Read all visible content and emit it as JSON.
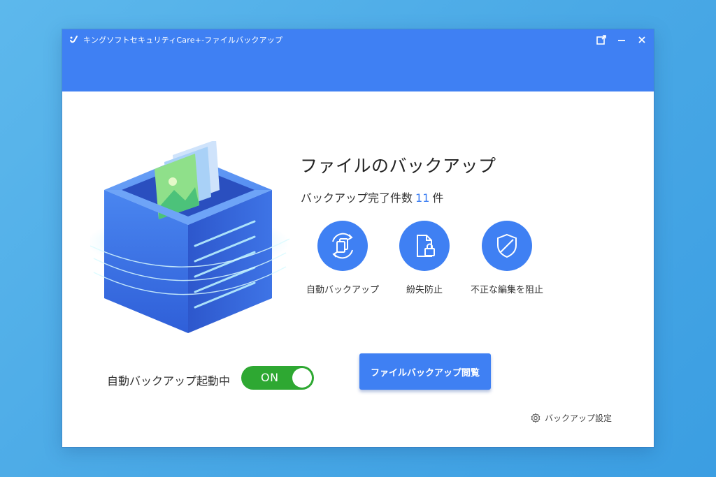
{
  "window": {
    "title": "キングソフトセキュリティCare+-ファイルバックアップ",
    "controls": {
      "new_window_icon": "new-window-icon",
      "minimize_icon": "minimize-icon",
      "close_icon": "close-icon"
    }
  },
  "main": {
    "heading": "ファイルのバックアップ",
    "count_prefix": "バックアップ完了件数",
    "count_value": "11",
    "count_suffix": "件",
    "features": [
      {
        "label": "自動バックアップ",
        "icon": "copy-sync-icon"
      },
      {
        "label": "紛失防止",
        "icon": "file-lock-icon"
      },
      {
        "label": "不正な編集を阻止",
        "icon": "shield-icon"
      }
    ],
    "auto_backup_label": "自動バックアップ起動中",
    "toggle": {
      "state": "ON",
      "on": true
    },
    "browse_button": "ファイルバックアップ閲覧",
    "settings_link": "バックアップ設定"
  },
  "colors": {
    "accent": "#3f80f3",
    "toggle_on": "#2ea832",
    "background": "#4aa9e6"
  }
}
